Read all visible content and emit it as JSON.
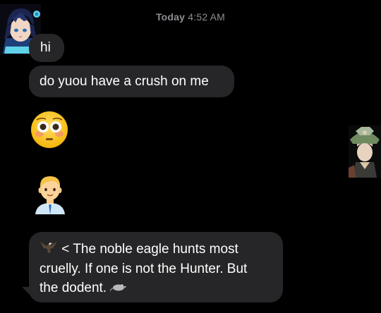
{
  "thread": {
    "timestamp_day": "Today",
    "timestamp_time": "4:52 AM"
  },
  "messages": [
    {
      "text": "hi"
    },
    {
      "text": "do yuou have a crush on me"
    },
    {
      "emoji": "flushed-face-emoji"
    },
    {
      "emoji": "man-emoji"
    },
    {
      "line1": "< The noble eagle hunts most",
      "line2": "cruelly. If one is not the Hunter. But",
      "line3": "the dodent."
    }
  ],
  "colors": {
    "background": "#000000",
    "bubble": "#262628",
    "timestamp": "#8e8e93",
    "text": "#ffffff"
  },
  "icons": {
    "eagle": "eagle-icon",
    "rat": "rat-icon"
  }
}
